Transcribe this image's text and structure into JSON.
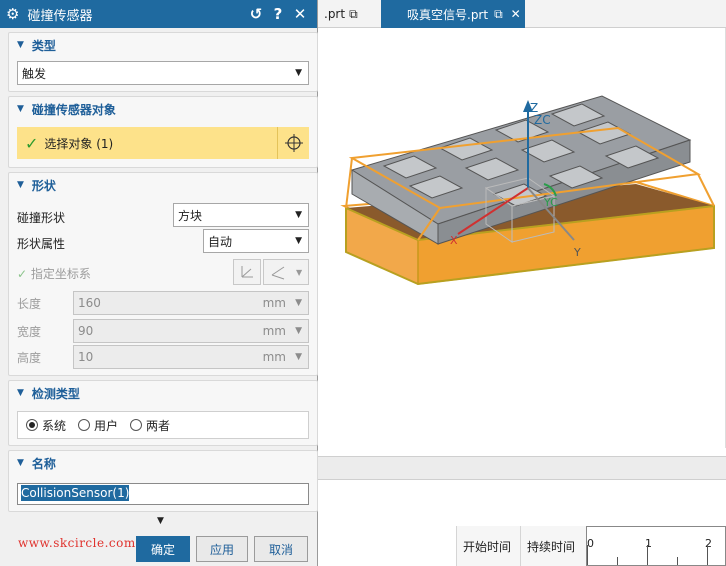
{
  "tabs": [
    {
      "label": ".prt",
      "active": false
    },
    {
      "label": "吸真空信号.prt",
      "active": true
    }
  ],
  "dialog": {
    "title": "碰撞传感器",
    "sections": {
      "type": {
        "header": "类型",
        "selected": "触发"
      },
      "object": {
        "header": "碰撞传感器对象",
        "select_label": "选择对象 (1)"
      },
      "shape": {
        "header": "形状",
        "shape_label": "碰撞形状",
        "shape_value": "方块",
        "attr_label": "形状属性",
        "attr_value": "自动",
        "csys_label": "指定坐标系",
        "length_label": "长度",
        "length_value": "160",
        "length_unit": "mm",
        "width_label": "宽度",
        "width_value": "90",
        "width_unit": "mm",
        "height_label": "高度",
        "height_value": "10",
        "height_unit": "mm"
      },
      "detect": {
        "header": "检测类型",
        "options": [
          "系统",
          "用户",
          "两者"
        ],
        "selected_index": 0
      },
      "name": {
        "header": "名称",
        "value": "CollisionSensor(1)"
      }
    },
    "buttons": {
      "ok": "确定",
      "apply": "应用",
      "cancel": "取消"
    }
  },
  "viewport": {
    "axis_labels": {
      "z": "Z",
      "zc": "ZC",
      "yc": "YC",
      "y": "Y",
      "x": "X"
    }
  },
  "timeline": {
    "col_start": "开始时间",
    "col_duration": "持续时间",
    "ruler_ticks": [
      "0",
      "1",
      "2"
    ]
  },
  "watermark": "www.skcircle.com 勇哥",
  "colors": {
    "accent": "#1f6aa0",
    "selection": "#fde28a",
    "sensor_box": "#f0a030",
    "plate": "#8b5a2b",
    "block": "#8a8f94"
  }
}
